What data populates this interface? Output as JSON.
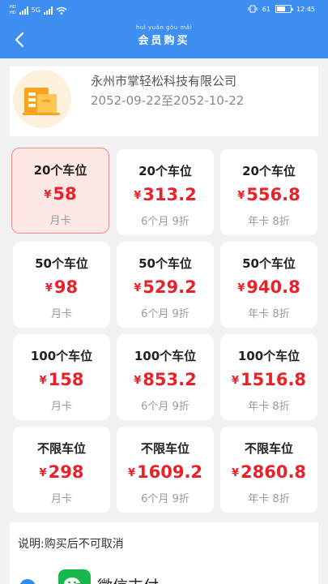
{
  "status_bar": {
    "sim_labels": [
      "HD",
      "HD"
    ],
    "net_label": "5G",
    "battery_text": "61",
    "battery_level": 0.61,
    "time": "12:45"
  },
  "header": {
    "title_pinyin": "huì yuán gòu mǎi",
    "title": "会员购买"
  },
  "company": {
    "name": "永州市掌轻松科技有限公司",
    "date_range": "2052-09-22至2052-10-22"
  },
  "plans": [
    {
      "spots": "20个车位",
      "currency": "¥",
      "price": "58",
      "note": "月卡"
    },
    {
      "spots": "20个车位",
      "currency": "¥",
      "price": "313.2",
      "note": "6个月 9折"
    },
    {
      "spots": "20个车位",
      "currency": "¥",
      "price": "556.8",
      "note": "年卡 8折"
    },
    {
      "spots": "50个车位",
      "currency": "¥",
      "price": "98",
      "note": "月卡"
    },
    {
      "spots": "50个车位",
      "currency": "¥",
      "price": "529.2",
      "note": "6个月 9折"
    },
    {
      "spots": "50个车位",
      "currency": "¥",
      "price": "940.8",
      "note": "年卡 8折"
    },
    {
      "spots": "100个车位",
      "currency": "¥",
      "price": "158",
      "note": "月卡"
    },
    {
      "spots": "100个车位",
      "currency": "¥",
      "price": "853.2",
      "note": "6个月 9折"
    },
    {
      "spots": "100个车位",
      "currency": "¥",
      "price": "1516.8",
      "note": "年卡 8折"
    },
    {
      "spots": "不限车位",
      "currency": "¥",
      "price": "298",
      "note": "月卡"
    },
    {
      "spots": "不限车位",
      "currency": "¥",
      "price": "1609.2",
      "note": "6个月 9折"
    },
    {
      "spots": "不限车位",
      "currency": "¥",
      "price": "2860.8",
      "note": "年卡 8折"
    }
  ],
  "notice": "说明:购买后不可取消",
  "payment": {
    "method_label": "微信支付"
  },
  "colors": {
    "header": "#3f8ff2",
    "price": "#e8212b",
    "selected_bg": "#fde8e5",
    "selected_border": "#f08d86",
    "wechat": "#19b84d"
  },
  "icons": {
    "back": "chevron-left-icon",
    "company": "building-icon",
    "wechat": "wechat-pay-icon",
    "radio": "radio-selected-icon"
  }
}
